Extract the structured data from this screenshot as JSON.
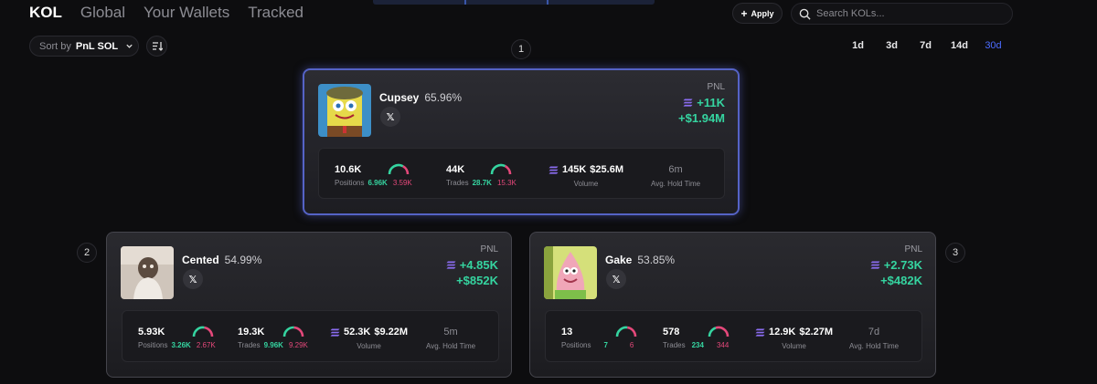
{
  "nav": {
    "tabs": [
      {
        "label": "KOL",
        "active": true
      },
      {
        "label": "Global",
        "active": false
      },
      {
        "label": "Your Wallets",
        "active": false
      },
      {
        "label": "Tracked",
        "active": false
      }
    ],
    "apply_label": "Apply",
    "search_placeholder": "Search KOLs..."
  },
  "sort": {
    "label": "Sort by",
    "value": "PnL SOL"
  },
  "periods": [
    {
      "label": "1d",
      "active": false
    },
    {
      "label": "3d",
      "active": false
    },
    {
      "label": "7d",
      "active": false
    },
    {
      "label": "14d",
      "active": false
    },
    {
      "label": "30d",
      "active": true
    }
  ],
  "colors": {
    "accent": "#4c6cff",
    "positive": "#35d4a0",
    "negative": "#e4487a",
    "highlight_border": "#5563c6"
  },
  "icons": {
    "apply": "plus-icon",
    "search": "search-icon",
    "sort_dropdown": "chevron-down-icon",
    "sort_order": "sort-order-icon",
    "social": "x-icon",
    "currency": "solana-icon"
  },
  "kols": [
    {
      "rank": "1",
      "name": "Cupsey",
      "pct": "65.96%",
      "pnl_label": "PNL",
      "pnl_sol": "+11K",
      "pnl_usd": "+$1.94M",
      "positions": {
        "total": "10.6K",
        "label": "Positions",
        "win": "6.96K",
        "loss": "3.59K",
        "win_ratio": 0.66
      },
      "trades": {
        "total": "44K",
        "label": "Trades",
        "win": "28.7K",
        "loss": "15.3K",
        "win_ratio": 0.65
      },
      "volume": {
        "sol": "145K",
        "usd": "$25.6M",
        "label": "Volume"
      },
      "hold": {
        "value": "6m",
        "label": "Avg. Hold Time"
      }
    },
    {
      "rank": "2",
      "name": "Cented",
      "pct": "54.99%",
      "pnl_label": "PNL",
      "pnl_sol": "+4.85K",
      "pnl_usd": "+$852K",
      "positions": {
        "total": "5.93K",
        "label": "Positions",
        "win": "3.26K",
        "loss": "2.67K",
        "win_ratio": 0.55
      },
      "trades": {
        "total": "19.3K",
        "label": "Trades",
        "win": "9.96K",
        "loss": "9.29K",
        "win_ratio": 0.52
      },
      "volume": {
        "sol": "52.3K",
        "usd": "$9.22M",
        "label": "Volume"
      },
      "hold": {
        "value": "5m",
        "label": "Avg. Hold Time"
      }
    },
    {
      "rank": "3",
      "name": "Gake",
      "pct": "53.85%",
      "pnl_label": "PNL",
      "pnl_sol": "+2.73K",
      "pnl_usd": "+$482K",
      "positions": {
        "total": "13",
        "label": "Positions",
        "win": "7",
        "loss": "6",
        "win_ratio": 0.54
      },
      "trades": {
        "total": "578",
        "label": "Trades",
        "win": "234",
        "loss": "344",
        "win_ratio": 0.4
      },
      "volume": {
        "sol": "12.9K",
        "usd": "$2.27M",
        "label": "Volume"
      },
      "hold": {
        "value": "7d",
        "label": "Avg. Hold Time"
      }
    }
  ]
}
